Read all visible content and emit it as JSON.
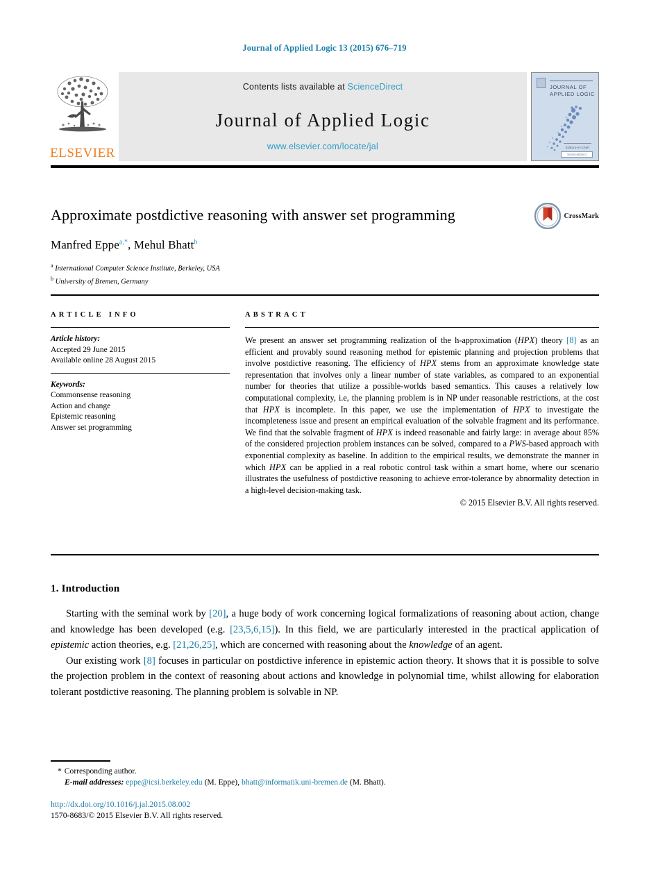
{
  "running_head": "Journal of Applied Logic 13 (2015) 676–719",
  "masthead": {
    "publisher_name": "ELSEVIER",
    "contents_prefix": "Contents lists available at",
    "sciencedirect": "ScienceDirect",
    "journal_name": "Journal of Applied Logic",
    "journal_url": "www.elsevier.com/locate/jal",
    "cover": {
      "title_line1": "JOURNAL OF",
      "title_line2": "APPLIED LOGIC",
      "foot_text": "Editors-in-Chief",
      "badge_text": "ScienceDirect"
    }
  },
  "title": {
    "text": "Approximate postdictive reasoning with answer set programming",
    "crossmark_label": "CrossMark"
  },
  "authors": {
    "author1_name": "Manfred Eppe",
    "author1_marks": "a,*",
    "separator": ", ",
    "author2_name": "Mehul Bhatt",
    "author2_marks": "b"
  },
  "affiliations": [
    {
      "mark": "a",
      "text": "International Computer Science Institute, Berkeley, USA"
    },
    {
      "mark": "b",
      "text": "University of Bremen, Germany"
    }
  ],
  "article_info": {
    "heading": "ARTICLE INFO",
    "history_label": "Article history:",
    "history_lines": [
      "Accepted 29 June 2015",
      "Available online 28 August 2015"
    ],
    "keywords_label": "Keywords:",
    "keywords": [
      "Commonsense reasoning",
      "Action and change",
      "Epistemic reasoning",
      "Answer set programming"
    ]
  },
  "abstract": {
    "heading": "ABSTRACT",
    "p1_a": "We present an answer set programming realization of the h-approximation (",
    "p1_hpx1": "HPX",
    "p1_b": ") theory ",
    "p1_cite": "[8]",
    "p1_c": " as an efficient and provably sound reasoning method for epistemic planning and projection problems that involve postdictive reasoning. The efficiency of ",
    "p1_hpx2": "HPX",
    "p1_d": " stems from an approximate knowledge state representation that involves only a linear number of state variables, as compared to an exponential number for theories that utilize a possible-worlds based semantics. This causes a relatively low computational complexity, i.e, the planning problem is in NP under reasonable restrictions, at the cost that ",
    "p1_hpx3": "HPX",
    "p1_e": " is incomplete. In this paper, we use the implementation of ",
    "p1_hpx4": "HPX",
    "p1_f": " to investigate the incompleteness issue and present an empirical evaluation of the solvable fragment and its performance. We find that the solvable fragment of ",
    "p1_hpx5": "HPX",
    "p1_g": " is indeed reasonable and fairly large: in average about 85% of the considered projection problem instances can be solved, compared to a ",
    "p1_pws": "PWS",
    "p1_h": "-based approach with exponential complexity as baseline. In addition to the empirical results, we demonstrate the manner in which ",
    "p1_hpx6": "HPX",
    "p1_i": " can be applied in a real robotic control task within a smart home, where our scenario illustrates the usefulness of postdictive reasoning to achieve error-tolerance by abnormality detection in a high-level decision-making task.",
    "copyright": "© 2015 Elsevier B.V. All rights reserved."
  },
  "body": {
    "section_heading": "1. Introduction",
    "para1_a": "Starting with the seminal work by ",
    "para1_cite1": "[20]",
    "para1_b": ", a huge body of work concerning logical formalizations of reasoning about action, change and knowledge has been developed (e.g. ",
    "para1_cite2": "[23,5,6,15]",
    "para1_c": "). In this field, we are particularly interested in the practical application of ",
    "para1_ital": "epistemic",
    "para1_d": " action theories, e.g. ",
    "para1_cite3": "[21,26,25]",
    "para1_e": ", which are concerned with reasoning about the ",
    "para1_ital2": "knowledge",
    "para1_f": " of an agent.",
    "para2_a": "Our existing work ",
    "para2_cite": "[8]",
    "para2_b": " focuses in particular on postdictive inference in epistemic action theory. It shows that it is possible to solve the projection problem in the context of reasoning about actions and knowledge in polynomial time, whilst allowing for elaboration tolerant postdictive reasoning. The planning problem is solvable in NP."
  },
  "footnotes": {
    "corresponding_star": "*",
    "corresponding_text": "Corresponding author.",
    "email_label": "E-mail addresses:",
    "email1": "eppe@icsi.berkeley.edu",
    "email1_owner": " (M. Eppe), ",
    "email2": "bhatt@informatik.uni-bremen.de",
    "email2_owner": " (M. Bhatt)."
  },
  "bottom": {
    "doi": "http://dx.doi.org/10.1016/j.jal.2015.08.002",
    "issn_line": "1570-8683/© 2015 Elsevier B.V. All rights reserved."
  },
  "colors": {
    "link_blue": "#1a7fa8",
    "sd_blue": "#2e9bc6",
    "elsevier_orange": "#f08020",
    "cover_blue": "#cfdcec"
  }
}
